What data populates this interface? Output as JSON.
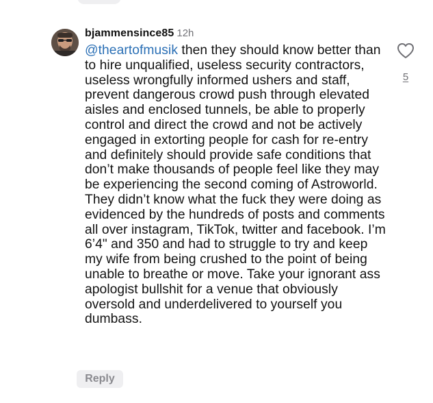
{
  "comment": {
    "username": "bjammensince85",
    "timestamp": "12h",
    "mention": "@theartofmusik",
    "text": " then they should know better than to hire unqualified, useless security contractors, useless wrongfully informed ushers and staff, prevent dangerous crowd push through elevated aisles and enclosed tunnels, be able to properly control and direct the crowd and not be actively engaged in extorting people for cash for re-entry and definitely should provide safe conditions that don’t make thousands of people feel like they may be experiencing the second coming of Astroworld. They didn’t know what the fuck they were doing as evidenced by the hundreds of posts and comments all over instagram, TikTok, twitter and facebook. I’m 6’4\" and 350 and had to struggle to try and keep my wife from being crushed to the point of being unable to breathe or move. Take your ignorant ass apologist bullshit for a venue that obviously oversold and underdelivered to yourself you dumbass.",
    "like_count": "5",
    "reply_label": "Reply",
    "like_icon": "heart-outline-icon",
    "mention_color": "#2a6fb5"
  }
}
